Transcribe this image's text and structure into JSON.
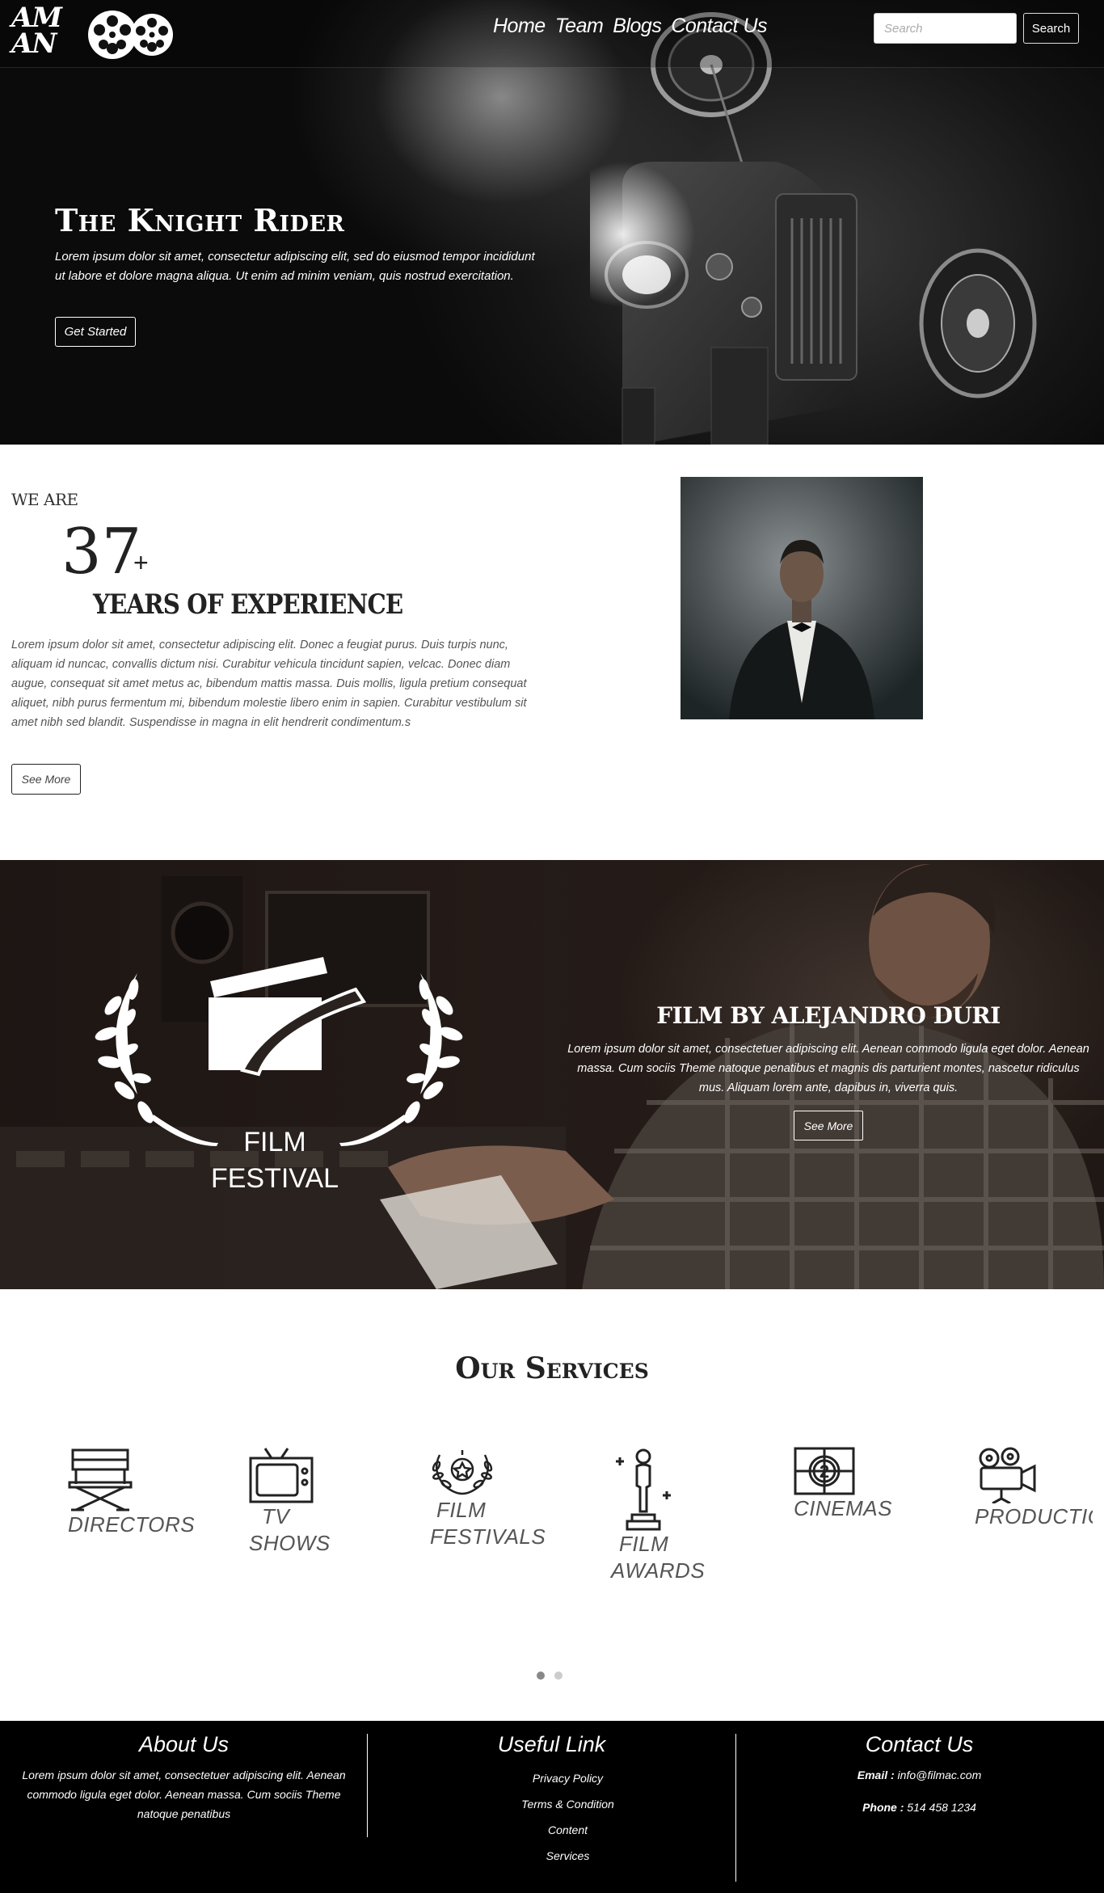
{
  "nav": {
    "logo": {
      "line1": "AM",
      "line2": "AN"
    },
    "links": [
      "Home",
      "Team",
      "Blogs",
      "Contact Us"
    ],
    "search": {
      "placeholder": "Search",
      "button": "Search"
    }
  },
  "hero": {
    "title": "The Knight Rider",
    "text": "Lorem ipsum dolor sit amet, consectetur adipiscing elit, sed do eiusmod tempor incididunt ut labore et dolore magna aliqua. Ut enim ad minim veniam, quis nostrud exercitation.",
    "button": "Get Started"
  },
  "about": {
    "we_are": "WE ARE",
    "years": "37",
    "plus": "+",
    "heading": "YEARS OF EXPERIENCE",
    "text": "Lorem ipsum dolor sit amet, consectetur adipiscing elit. Donec a feugiat purus. Duis turpis nunc, aliquam id nuncac, convallis dictum nisi. Curabitur vehicula tincidunt sapien, velcac. Donec diam augue, consequat sit amet metus ac, bibendum mattis massa. Duis mollis, ligula pretium consequat aliquet, nibh purus fermentum mi, bibendum molestie libero enim in sapien. Curabitur vestibulum sit amet nibh sed blandit. Suspendisse in magna in elit hendrerit condimentum.s",
    "button": "See More"
  },
  "festival": {
    "logo_line1": "FILM",
    "logo_line2": "FESTIVAL",
    "title": "FILM BY ALEJANDRO DURI",
    "text": "Lorem ipsum dolor sit amet, consectetuer adipiscing elit. Aenean commodo ligula eget dolor. Aenean massa. Cum sociis Theme natoque penatibus et magnis dis parturient montes, nascetur ridiculus mus. Aliquam lorem ante, dapibus in, viverra quis.",
    "button": "See More"
  },
  "services": {
    "title": "Our Services",
    "items": [
      {
        "line1": "DIRECTORS",
        "line2": "",
        "icon": "director-chair-icon"
      },
      {
        "line1": "TV",
        "line2": "SHOWS",
        "icon": "tv-icon"
      },
      {
        "line1": "FILM",
        "line2": "FESTIVALS",
        "icon": "laurel-star-icon"
      },
      {
        "line1": "FILM",
        "line2": "AWARDS",
        "icon": "award-statue-icon"
      },
      {
        "line1": "CINEMAS",
        "line2": "",
        "icon": "film-countdown-icon"
      },
      {
        "line1": "PRODUCTIO",
        "line2": "",
        "icon": "movie-camera-icon"
      }
    ],
    "active_dot": 1,
    "dot_count": 2
  },
  "footer": {
    "about": {
      "heading": "About Us",
      "text": "Lorem ipsum dolor sit amet, consectetuer adipiscing elit. Aenean commodo ligula eget dolor. Aenean massa. Cum sociis Theme natoque penatibus"
    },
    "links": {
      "heading": "Useful Link",
      "items": [
        "Privacy Policy",
        "Terms & Condition",
        "Content",
        "Services"
      ]
    },
    "contact": {
      "heading": "Contact Us",
      "email_label": "Email :",
      "email": "info@filmac.com",
      "phone_label": "Phone :",
      "phone": "514 458 1234"
    }
  }
}
